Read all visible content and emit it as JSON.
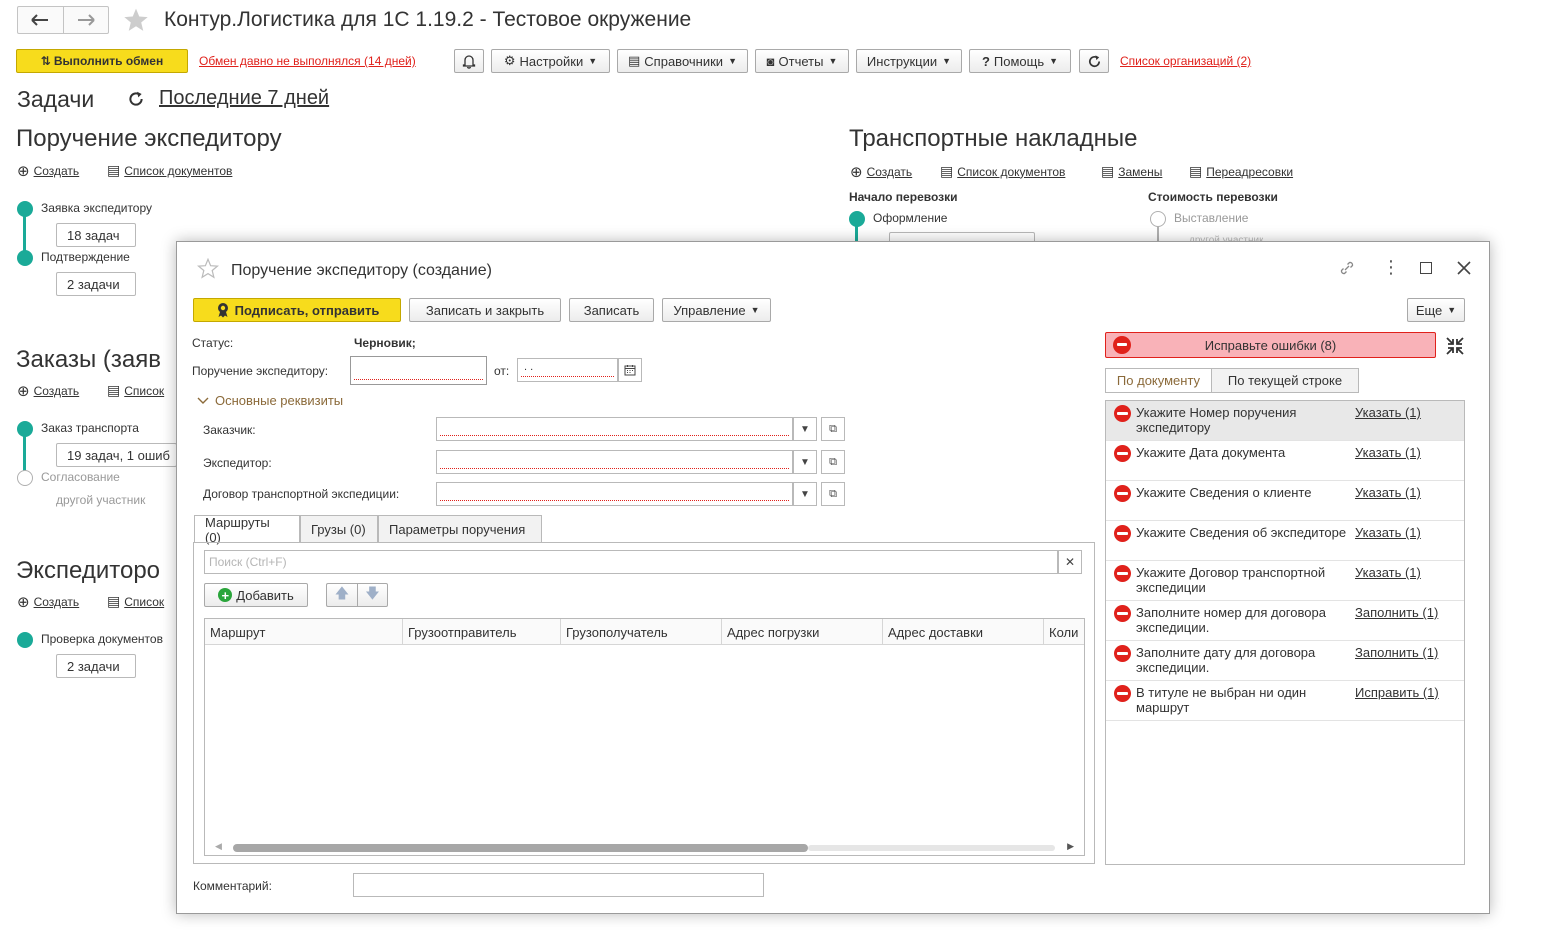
{
  "window": {
    "title": "Контур.Логистика для 1С 1.19.2 - Тестовое окружение"
  },
  "toolbar": {
    "exchange_label": "Выполнить обмен",
    "exchange_warning": "Обмен давно не выполнялся (14 дней)",
    "settings": "Настройки",
    "references": "Справочники",
    "reports": "Отчеты",
    "instructions": "Инструкции",
    "help": "Помощь",
    "org_list": "Список организаций (2)"
  },
  "tasks": {
    "title": "Задачи",
    "period": "Последние 7 дней"
  },
  "forwarder_order": {
    "title": "Поручение экспедитору",
    "create": "Создать",
    "doc_list": "Список документов",
    "step1_label": "Заявка экспедитору",
    "step1_count": "18 задач",
    "step2_label": "Подтверждение",
    "step2_count": "2 задачи"
  },
  "orders": {
    "title": "Заказы (заяв",
    "create": "Создать",
    "doc_list": "Список",
    "step1_label": "Заказ транспорта",
    "step1_count": "19 задач, 1 ошиб",
    "step2_label": "Согласование",
    "step2_sub": "другой участник"
  },
  "expeditor": {
    "title": "Экспедиторо",
    "create": "Создать",
    "doc_list": "Список",
    "step1_label": "Проверка документов",
    "step1_count": "2 задачи"
  },
  "waybills": {
    "title": "Транспортные накладные",
    "create": "Создать",
    "doc_list": "Список документов",
    "replacements": "Замены",
    "redirects": "Переадресовки",
    "col1_title": "Начало перевозки",
    "col1_step": "Оформление",
    "col2_title": "Стоимость перевозки",
    "col2_step": "Выставление",
    "col2_sub": "другой участник"
  },
  "modal": {
    "title": "Поручение экспедитору (создание)",
    "sign_send": "Подписать, отправить",
    "save_close": "Записать и закрыть",
    "save": "Записать",
    "manage": "Управление",
    "more": "Еще",
    "status_label": "Статус:",
    "status_value": "Черновик;",
    "order_label": "Поручение экспедитору:",
    "order_value": "",
    "from_label": "от:",
    "date_value": ". .",
    "main_props": "Основные реквизиты",
    "customer_label": "Заказчик:",
    "forwarder_label": "Экспедитор:",
    "contract_label": "Договор транспортной экспедиции:",
    "tabs": [
      "Маршруты (0)",
      "Грузы (0)",
      "Параметры поручения"
    ],
    "search_placeholder": "Поиск (Ctrl+F)",
    "add_label": "Добавить",
    "columns": [
      "Маршрут",
      "Грузоотправитель",
      "Грузополучатель",
      "Адрес погрузки",
      "Адрес доставки",
      "Коли"
    ],
    "comment_label": "Комментарий:",
    "comment_value": "",
    "errors_button": "Исправьте ошибки (8)",
    "filter_doc": "По документу",
    "filter_row": "По текущей строке",
    "errors": [
      {
        "text": "Укажите Номер поручения экспедитору",
        "action": "Указать (1)"
      },
      {
        "text": "Укажите Дата документа",
        "action": "Указать (1)"
      },
      {
        "text": "Укажите Сведения о клиенте",
        "action": "Указать (1)"
      },
      {
        "text": "Укажите Сведения об экспедиторе",
        "action": "Указать (1)"
      },
      {
        "text": "Укажите Договор транспортной экспедиции",
        "action": "Указать (1)"
      },
      {
        "text": "Заполните номер для договора экспедиции.",
        "action": "Заполнить (1)"
      },
      {
        "text": "Заполните дату для договора экспедиции.",
        "action": "Заполнить (1)"
      },
      {
        "text": "В титуле не выбран ни один маршрут",
        "action": "Исправить (1)"
      }
    ]
  },
  "colors": {
    "accent_yellow": "#f7dc1c",
    "teal": "#1aaa98",
    "error_red": "#e0211b",
    "error_bg": "#f9b2b8"
  }
}
